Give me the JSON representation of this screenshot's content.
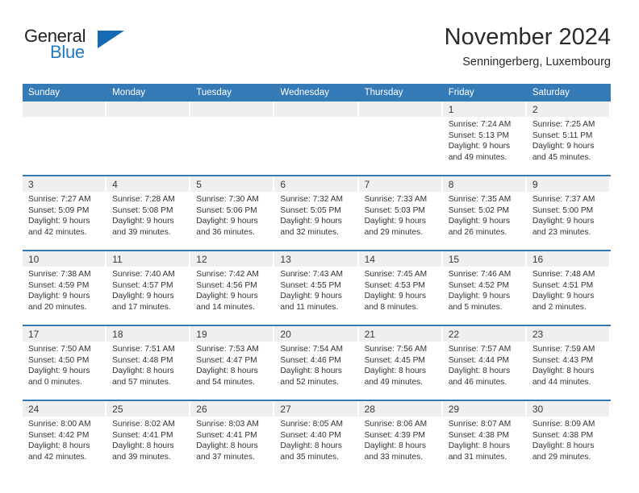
{
  "brand": {
    "word_one": "General",
    "word_two": "Blue",
    "triangle_color": "#1669b2",
    "blue_color": "#1f7ac4",
    "dark_color": "#231f20"
  },
  "header": {
    "month_title": "November 2024",
    "location": "Senningerberg, Luxembourg"
  },
  "theme": {
    "header_blue": "#347ab7",
    "daynum_strip": "#efefef",
    "cell_background": "#ffffff",
    "text_color": "#333333"
  },
  "calendar": {
    "weekday_headers": [
      "Sunday",
      "Monday",
      "Tuesday",
      "Wednesday",
      "Thursday",
      "Friday",
      "Saturday"
    ],
    "weeks": [
      [
        {
          "day": "",
          "blank": true,
          "sunrise": "",
          "sunset": "",
          "daylight1": "",
          "daylight2": ""
        },
        {
          "day": "",
          "blank": true,
          "sunrise": "",
          "sunset": "",
          "daylight1": "",
          "daylight2": ""
        },
        {
          "day": "",
          "blank": true,
          "sunrise": "",
          "sunset": "",
          "daylight1": "",
          "daylight2": ""
        },
        {
          "day": "",
          "blank": true,
          "sunrise": "",
          "sunset": "",
          "daylight1": "",
          "daylight2": ""
        },
        {
          "day": "",
          "blank": true,
          "sunrise": "",
          "sunset": "",
          "daylight1": "",
          "daylight2": ""
        },
        {
          "day": "1",
          "blank": false,
          "sunrise": "Sunrise: 7:24 AM",
          "sunset": "Sunset: 5:13 PM",
          "daylight1": "Daylight: 9 hours",
          "daylight2": "and 49 minutes."
        },
        {
          "day": "2",
          "blank": false,
          "sunrise": "Sunrise: 7:25 AM",
          "sunset": "Sunset: 5:11 PM",
          "daylight1": "Daylight: 9 hours",
          "daylight2": "and 45 minutes."
        }
      ],
      [
        {
          "day": "3",
          "blank": false,
          "sunrise": "Sunrise: 7:27 AM",
          "sunset": "Sunset: 5:09 PM",
          "daylight1": "Daylight: 9 hours",
          "daylight2": "and 42 minutes."
        },
        {
          "day": "4",
          "blank": false,
          "sunrise": "Sunrise: 7:28 AM",
          "sunset": "Sunset: 5:08 PM",
          "daylight1": "Daylight: 9 hours",
          "daylight2": "and 39 minutes."
        },
        {
          "day": "5",
          "blank": false,
          "sunrise": "Sunrise: 7:30 AM",
          "sunset": "Sunset: 5:06 PM",
          "daylight1": "Daylight: 9 hours",
          "daylight2": "and 36 minutes."
        },
        {
          "day": "6",
          "blank": false,
          "sunrise": "Sunrise: 7:32 AM",
          "sunset": "Sunset: 5:05 PM",
          "daylight1": "Daylight: 9 hours",
          "daylight2": "and 32 minutes."
        },
        {
          "day": "7",
          "blank": false,
          "sunrise": "Sunrise: 7:33 AM",
          "sunset": "Sunset: 5:03 PM",
          "daylight1": "Daylight: 9 hours",
          "daylight2": "and 29 minutes."
        },
        {
          "day": "8",
          "blank": false,
          "sunrise": "Sunrise: 7:35 AM",
          "sunset": "Sunset: 5:02 PM",
          "daylight1": "Daylight: 9 hours",
          "daylight2": "and 26 minutes."
        },
        {
          "day": "9",
          "blank": false,
          "sunrise": "Sunrise: 7:37 AM",
          "sunset": "Sunset: 5:00 PM",
          "daylight1": "Daylight: 9 hours",
          "daylight2": "and 23 minutes."
        }
      ],
      [
        {
          "day": "10",
          "blank": false,
          "sunrise": "Sunrise: 7:38 AM",
          "sunset": "Sunset: 4:59 PM",
          "daylight1": "Daylight: 9 hours",
          "daylight2": "and 20 minutes."
        },
        {
          "day": "11",
          "blank": false,
          "sunrise": "Sunrise: 7:40 AM",
          "sunset": "Sunset: 4:57 PM",
          "daylight1": "Daylight: 9 hours",
          "daylight2": "and 17 minutes."
        },
        {
          "day": "12",
          "blank": false,
          "sunrise": "Sunrise: 7:42 AM",
          "sunset": "Sunset: 4:56 PM",
          "daylight1": "Daylight: 9 hours",
          "daylight2": "and 14 minutes."
        },
        {
          "day": "13",
          "blank": false,
          "sunrise": "Sunrise: 7:43 AM",
          "sunset": "Sunset: 4:55 PM",
          "daylight1": "Daylight: 9 hours",
          "daylight2": "and 11 minutes."
        },
        {
          "day": "14",
          "blank": false,
          "sunrise": "Sunrise: 7:45 AM",
          "sunset": "Sunset: 4:53 PM",
          "daylight1": "Daylight: 9 hours",
          "daylight2": "and 8 minutes."
        },
        {
          "day": "15",
          "blank": false,
          "sunrise": "Sunrise: 7:46 AM",
          "sunset": "Sunset: 4:52 PM",
          "daylight1": "Daylight: 9 hours",
          "daylight2": "and 5 minutes."
        },
        {
          "day": "16",
          "blank": false,
          "sunrise": "Sunrise: 7:48 AM",
          "sunset": "Sunset: 4:51 PM",
          "daylight1": "Daylight: 9 hours",
          "daylight2": "and 2 minutes."
        }
      ],
      [
        {
          "day": "17",
          "blank": false,
          "sunrise": "Sunrise: 7:50 AM",
          "sunset": "Sunset: 4:50 PM",
          "daylight1": "Daylight: 9 hours",
          "daylight2": "and 0 minutes."
        },
        {
          "day": "18",
          "blank": false,
          "sunrise": "Sunrise: 7:51 AM",
          "sunset": "Sunset: 4:48 PM",
          "daylight1": "Daylight: 8 hours",
          "daylight2": "and 57 minutes."
        },
        {
          "day": "19",
          "blank": false,
          "sunrise": "Sunrise: 7:53 AM",
          "sunset": "Sunset: 4:47 PM",
          "daylight1": "Daylight: 8 hours",
          "daylight2": "and 54 minutes."
        },
        {
          "day": "20",
          "blank": false,
          "sunrise": "Sunrise: 7:54 AM",
          "sunset": "Sunset: 4:46 PM",
          "daylight1": "Daylight: 8 hours",
          "daylight2": "and 52 minutes."
        },
        {
          "day": "21",
          "blank": false,
          "sunrise": "Sunrise: 7:56 AM",
          "sunset": "Sunset: 4:45 PM",
          "daylight1": "Daylight: 8 hours",
          "daylight2": "and 49 minutes."
        },
        {
          "day": "22",
          "blank": false,
          "sunrise": "Sunrise: 7:57 AM",
          "sunset": "Sunset: 4:44 PM",
          "daylight1": "Daylight: 8 hours",
          "daylight2": "and 46 minutes."
        },
        {
          "day": "23",
          "blank": false,
          "sunrise": "Sunrise: 7:59 AM",
          "sunset": "Sunset: 4:43 PM",
          "daylight1": "Daylight: 8 hours",
          "daylight2": "and 44 minutes."
        }
      ],
      [
        {
          "day": "24",
          "blank": false,
          "sunrise": "Sunrise: 8:00 AM",
          "sunset": "Sunset: 4:42 PM",
          "daylight1": "Daylight: 8 hours",
          "daylight2": "and 42 minutes."
        },
        {
          "day": "25",
          "blank": false,
          "sunrise": "Sunrise: 8:02 AM",
          "sunset": "Sunset: 4:41 PM",
          "daylight1": "Daylight: 8 hours",
          "daylight2": "and 39 minutes."
        },
        {
          "day": "26",
          "blank": false,
          "sunrise": "Sunrise: 8:03 AM",
          "sunset": "Sunset: 4:41 PM",
          "daylight1": "Daylight: 8 hours",
          "daylight2": "and 37 minutes."
        },
        {
          "day": "27",
          "blank": false,
          "sunrise": "Sunrise: 8:05 AM",
          "sunset": "Sunset: 4:40 PM",
          "daylight1": "Daylight: 8 hours",
          "daylight2": "and 35 minutes."
        },
        {
          "day": "28",
          "blank": false,
          "sunrise": "Sunrise: 8:06 AM",
          "sunset": "Sunset: 4:39 PM",
          "daylight1": "Daylight: 8 hours",
          "daylight2": "and 33 minutes."
        },
        {
          "day": "29",
          "blank": false,
          "sunrise": "Sunrise: 8:07 AM",
          "sunset": "Sunset: 4:38 PM",
          "daylight1": "Daylight: 8 hours",
          "daylight2": "and 31 minutes."
        },
        {
          "day": "30",
          "blank": false,
          "sunrise": "Sunrise: 8:09 AM",
          "sunset": "Sunset: 4:38 PM",
          "daylight1": "Daylight: 8 hours",
          "daylight2": "and 29 minutes."
        }
      ]
    ]
  }
}
